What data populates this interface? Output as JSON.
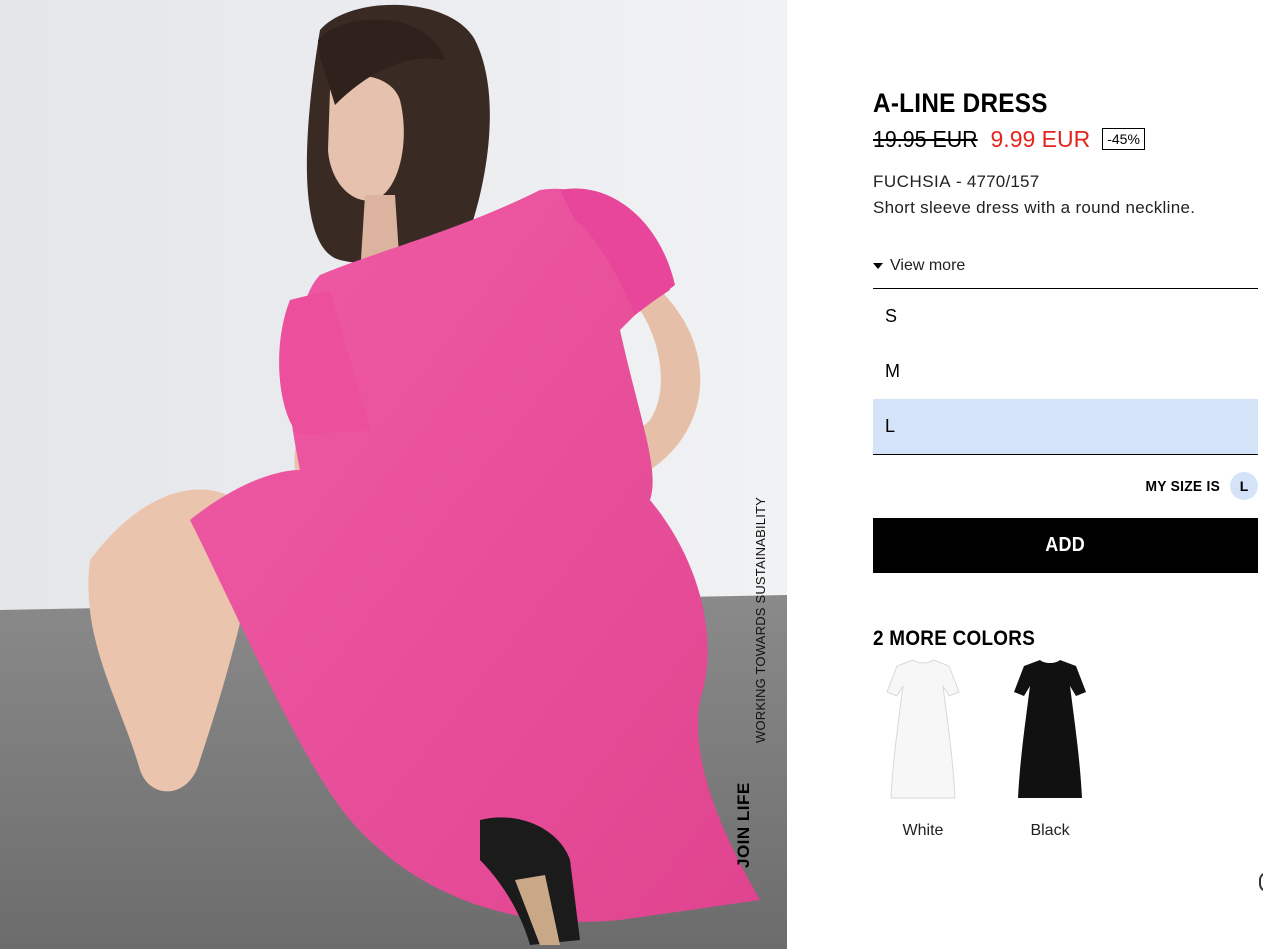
{
  "product": {
    "title": "A-LINE DRESS",
    "old_price": "19.95 EUR",
    "new_price": "9.99 EUR",
    "discount": "-45%",
    "color_name": "FUCHSIA",
    "reference": "4770/157",
    "separator": " - ",
    "description": "Short sleeve dress with a round neckline.",
    "view_more": "View more"
  },
  "badge": {
    "join_life": "JOIN LIFE",
    "sustainability": "WORKING TOWARDS SUSTAINABILITY"
  },
  "sizes": {
    "options": [
      "S",
      "M",
      "L"
    ],
    "selected": "L"
  },
  "my_size": {
    "label": "MY SIZE IS",
    "value": "L"
  },
  "add_button": "ADD",
  "more_colors": {
    "heading": "2 MORE COLORS",
    "items": [
      {
        "label": "White",
        "color": "#f7f7f7"
      },
      {
        "label": "Black",
        "color": "#111111"
      }
    ]
  },
  "colors": {
    "accent_sale": "#e3251f",
    "selected_size_bg": "#d4e3f7",
    "dress_fuchsia": "#ec4f9c"
  }
}
